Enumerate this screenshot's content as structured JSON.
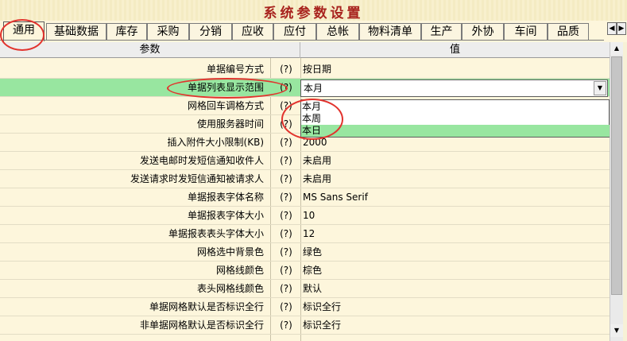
{
  "window": {
    "title": "系统参数设置"
  },
  "tabs": [
    {
      "label": "通用",
      "active": true
    },
    {
      "label": "基础数据"
    },
    {
      "label": "库存"
    },
    {
      "label": "采购"
    },
    {
      "label": "分销"
    },
    {
      "label": "应收"
    },
    {
      "label": "应付"
    },
    {
      "label": "总帐"
    },
    {
      "label": "物料清单"
    },
    {
      "label": "生产"
    },
    {
      "label": "外协"
    },
    {
      "label": "车间"
    },
    {
      "label": "品质"
    }
  ],
  "tab_scroll": {
    "left_icon": "◀",
    "right_icon": "▶"
  },
  "grid": {
    "headers": {
      "param": "参数",
      "value": "值"
    },
    "rows": [
      {
        "name": "单据编号方式",
        "help": "(?)",
        "value": "按日期"
      },
      {
        "name": "单据列表显示范围",
        "help": "(?)",
        "value": "本月",
        "selected": true
      },
      {
        "name": "网格回车调格方式",
        "help": "(?)",
        "value": ""
      },
      {
        "name": "使用服务器时间",
        "help": "(?)",
        "value": ""
      },
      {
        "name": "插入附件大小限制(KB)",
        "help": "(?)",
        "value": "2000"
      },
      {
        "name": "发送电邮时发短信通知收件人",
        "help": "(?)",
        "value": "未启用"
      },
      {
        "name": "发送请求时发短信通知被请求人",
        "help": "(?)",
        "value": "未启用"
      },
      {
        "name": "单据报表字体名称",
        "help": "(?)",
        "value": "MS Sans Serif"
      },
      {
        "name": "单据报表字体大小",
        "help": "(?)",
        "value": "10"
      },
      {
        "name": "单据报表表头字体大小",
        "help": "(?)",
        "value": "12"
      },
      {
        "name": "网格选中背景色",
        "help": "(?)",
        "value": "绿色"
      },
      {
        "name": "网格线颜色",
        "help": "(?)",
        "value": "棕色"
      },
      {
        "name": "表头网格线颜色",
        "help": "(?)",
        "value": "默认"
      },
      {
        "name": "单据网格默认是否标识全行",
        "help": "(?)",
        "value": "标识全行"
      },
      {
        "name": "非单据网格默认是否标识全行",
        "help": "(?)",
        "value": "标识全行"
      }
    ]
  },
  "dropdown": {
    "current": "本月",
    "button_icon": "▼",
    "options": [
      {
        "label": "本月"
      },
      {
        "label": "本周"
      },
      {
        "label": "本日",
        "highlighted": true
      }
    ]
  },
  "scrollbar": {
    "up_icon": "▲",
    "down_icon": "▼"
  },
  "colors": {
    "selection": "#98e6a0",
    "title": "#a8231e",
    "annotation": "#e2332d"
  }
}
